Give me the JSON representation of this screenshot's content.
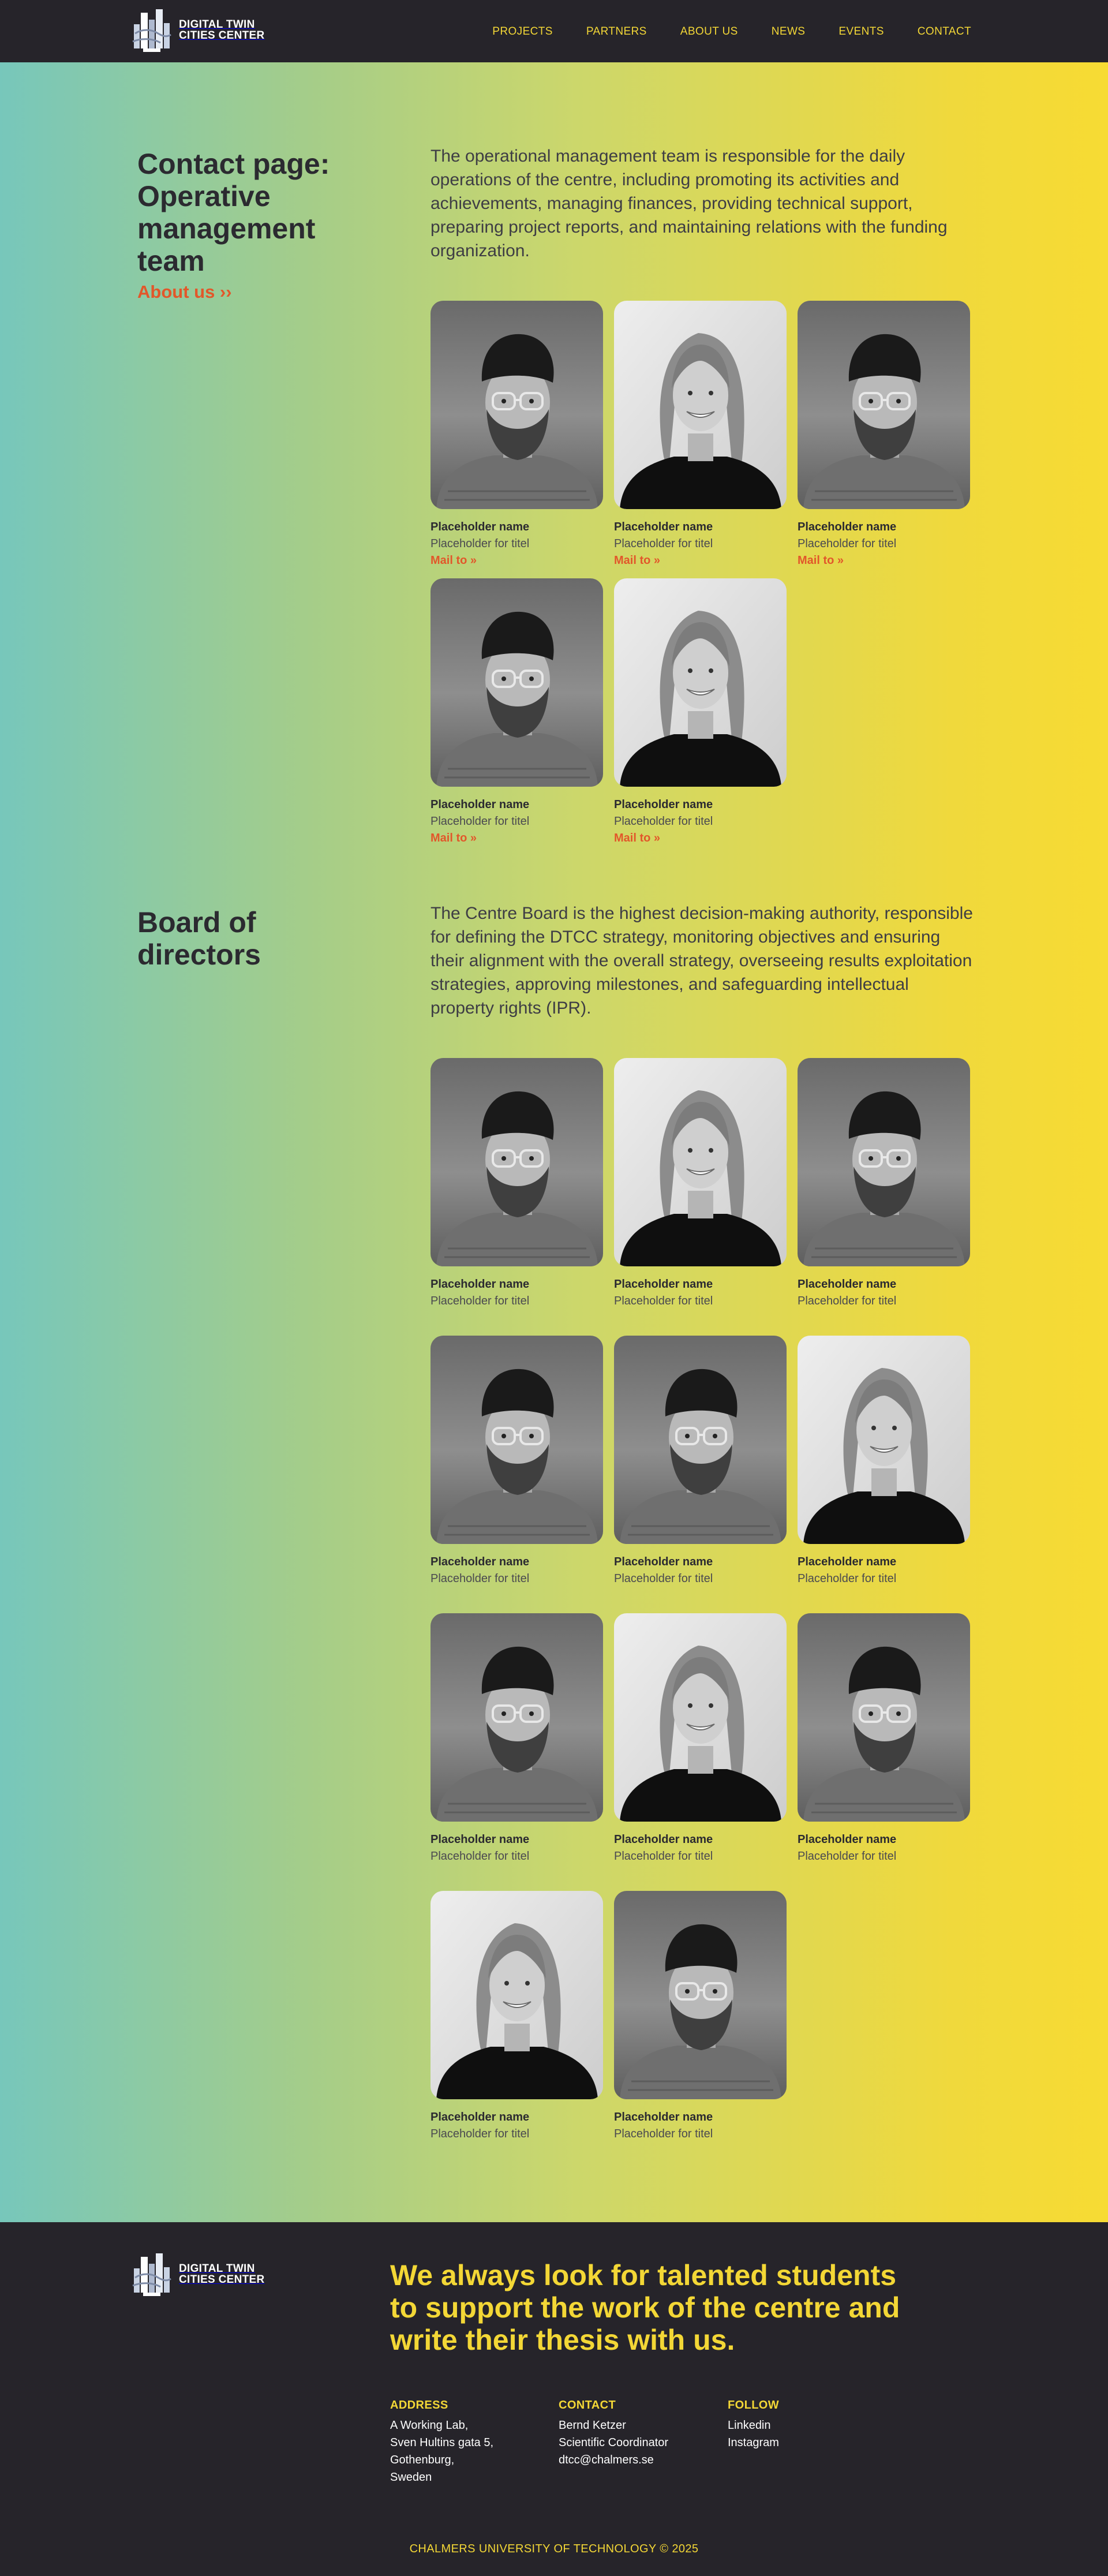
{
  "header": {
    "logo_text": [
      "DIGITAL TWIN",
      "CITIES CENTER"
    ],
    "nav": [
      "PROJECTS",
      "PARTNERS",
      "ABOUT US",
      "NEWS",
      "EVENTS",
      "CONTACT"
    ]
  },
  "operative": {
    "heading": [
      "Contact page:",
      "Operative",
      "management",
      "team"
    ],
    "about_link": "About us ››",
    "intro": "The operational management team is responsible for the daily operations of the centre, including promoting its activities and achievements, managing finances, providing technical support, preparing project reports, and maintaining relations with the funding organization.",
    "members": [
      {
        "name": "Placeholder name",
        "title": "Placeholder for titel",
        "mail": "Mail to »",
        "portrait": "man"
      },
      {
        "name": "Placeholder name",
        "title": "Placeholder for titel",
        "mail": "Mail to »",
        "portrait": "woman"
      },
      {
        "name": "Placeholder name",
        "title": "Placeholder for titel",
        "mail": "Mail to »",
        "portrait": "man"
      },
      {
        "name": "Placeholder name",
        "title": "Placeholder for titel",
        "mail": "Mail to »",
        "portrait": "man"
      },
      {
        "name": "Placeholder name",
        "title": "Placeholder for titel",
        "mail": "Mail to »",
        "portrait": "woman"
      }
    ]
  },
  "board": {
    "heading": [
      "Board of",
      "directors"
    ],
    "intro": "The Centre Board is the highest decision-making authority, responsible for defining the DTCC strategy, monitoring objectives and ensuring their alignment with the overall strategy, overseeing results exploitation strategies, approving milestones, and safeguarding intellectual property rights (IPR).",
    "members": [
      {
        "name": "Placeholder name",
        "title": "Placeholder for titel",
        "portrait": "man"
      },
      {
        "name": "Placeholder name",
        "title": "Placeholder for titel",
        "portrait": "woman"
      },
      {
        "name": "Placeholder name",
        "title": "Placeholder for titel",
        "portrait": "man"
      },
      {
        "name": "Placeholder name",
        "title": "Placeholder for titel",
        "portrait": "man"
      },
      {
        "name": "Placeholder name",
        "title": "Placeholder for titel",
        "portrait": "man"
      },
      {
        "name": "Placeholder name",
        "title": "Placeholder for titel",
        "portrait": "woman"
      },
      {
        "name": "Placeholder name",
        "title": "Placeholder for titel",
        "portrait": "man"
      },
      {
        "name": "Placeholder name",
        "title": "Placeholder for titel",
        "portrait": "woman"
      },
      {
        "name": "Placeholder name",
        "title": "Placeholder for titel",
        "portrait": "man"
      },
      {
        "name": "Placeholder name",
        "title": "Placeholder for titel",
        "portrait": "woman"
      },
      {
        "name": "Placeholder name",
        "title": "Placeholder for titel",
        "portrait": "man"
      }
    ]
  },
  "footer": {
    "logo_text": [
      "DIGITAL TWIN",
      "CITIES CENTER"
    ],
    "slogan": [
      "We always look for talented students",
      "to support the work of the centre and",
      "write their thesis with us."
    ],
    "address": {
      "heading": "ADDRESS",
      "lines": [
        "A Working Lab,",
        "Sven Hultins gata 5,",
        "Gothenburg,",
        "Sweden"
      ]
    },
    "contact": {
      "heading": "CONTACT",
      "lines": [
        "Bernd Ketzer",
        "Scientific Coordinator",
        "dtcc@chalmers.se"
      ]
    },
    "follow": {
      "heading": "FOLLOW",
      "lines": [
        "Linkedin",
        "Instagram"
      ]
    },
    "copyright": "CHALMERS UNIVERSITY OF TECHNOLOGY © 2025"
  },
  "colors": {
    "accent_yellow": "#f3d736",
    "link_orange": "#e2572a",
    "dark_bg": "#26242a"
  }
}
